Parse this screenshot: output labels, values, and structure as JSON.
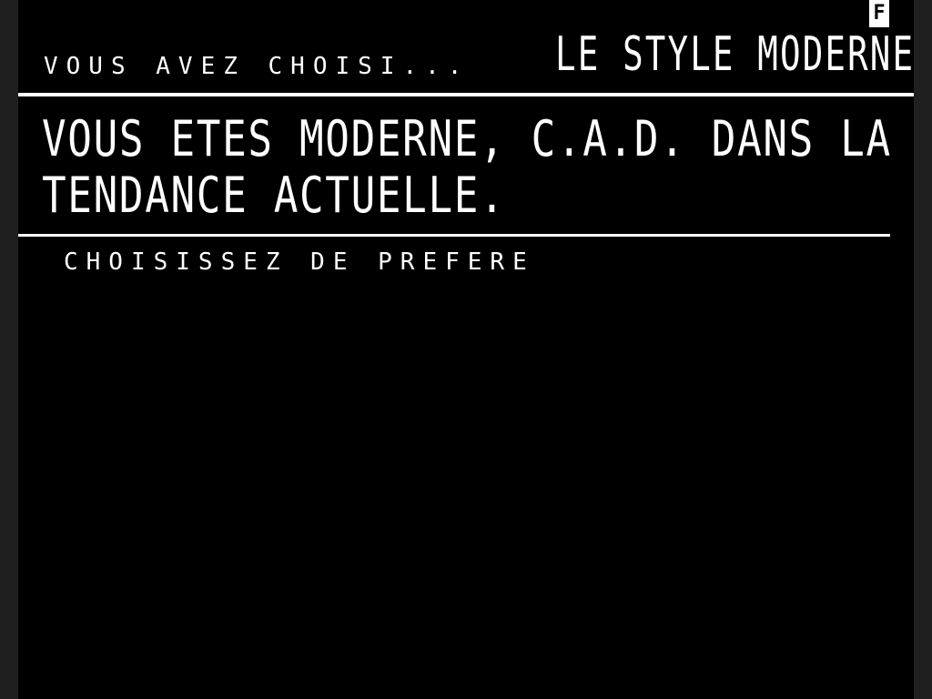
{
  "status": {
    "indicator": "F"
  },
  "header": {
    "intro": "VOUS AVEZ CHOISI...",
    "title": "LE STYLE MODERNE"
  },
  "message": {
    "line1": "VOUS ETES MODERNE, C.A.D. DANS LA",
    "line2": "TENDANCE ACTUELLE."
  },
  "prompt": {
    "label": "CHOISISSEZ DE PREFERE"
  },
  "colors": {
    "background": "#000000",
    "foreground": "#ffffff",
    "border": "#1f1f1f"
  }
}
